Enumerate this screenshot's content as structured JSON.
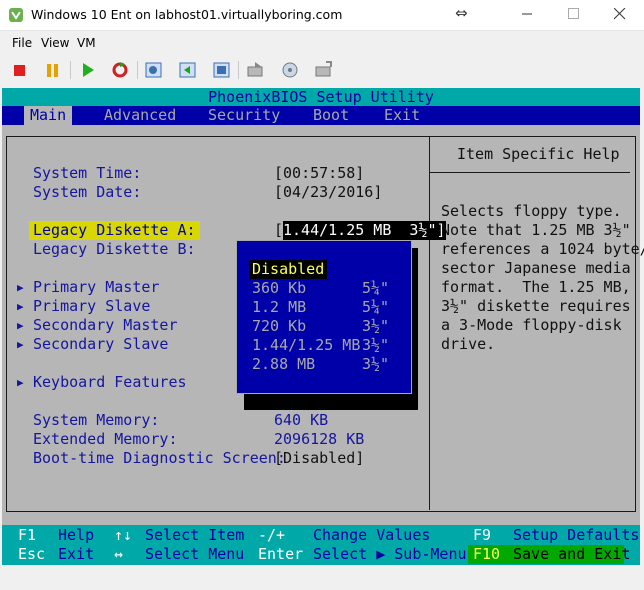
{
  "window": {
    "title": "Windows 10 Ent on labhost01.virtuallyboring.com",
    "resize_glyph": "⇔"
  },
  "menubar": [
    "File",
    "View",
    "VM"
  ],
  "toolbar": {
    "icons": [
      "stop-icon",
      "pause-icon",
      "play-icon",
      "reset-icon",
      "snapshot-icon",
      "revert-icon",
      "manage-snapshots-icon",
      "ctrl-alt-del-icon",
      "guest-install-icon",
      "enter-fullscreen-icon"
    ]
  },
  "bios": {
    "header": "PhoenixBIOS Setup Utility",
    "tabs": [
      "Main",
      "Advanced",
      "Security",
      "Boot",
      "Exit"
    ],
    "active_tab": "Main",
    "fields": [
      {
        "label": "System Time:",
        "value": "[00:57:58]"
      },
      {
        "label": "System Date:",
        "value": "[04/23/2016]"
      },
      {
        "label": "Legacy Diskette A:",
        "value": "[1.44/1.25 MB  3½\"]"
      },
      {
        "label": "Legacy Diskette B:",
        "value": ""
      }
    ],
    "submenus": [
      "Primary Master",
      "Primary Slave",
      "Secondary Master",
      "Secondary Slave",
      "Keyboard Features"
    ],
    "submenu_arrow": "▶",
    "memory": [
      {
        "label": "System Memory:",
        "value": "640 KB"
      },
      {
        "label": "Extended Memory:",
        "value": "2096128 KB"
      },
      {
        "label": "Boot-time Diagnostic Screen:",
        "value": "[Disabled]"
      }
    ],
    "value_prefix": "[",
    "selected_value_text": "1.44/1.25 MB  3½\"]",
    "help_title": "Item Specific Help",
    "help_lines": [
      "Selects floppy type.",
      "Note that 1.25 MB 3½\"",
      "references a 1024 byte/",
      "sector Japanese media",
      "format.  The 1.25 MB,",
      "3½\" diskette requires",
      "a 3-Mode floppy-disk",
      "drive."
    ],
    "popup": {
      "options": [
        {
          "label": "Disabled",
          "size": ""
        },
        {
          "label": "360 Kb",
          "size": "5¼\""
        },
        {
          "label": "1.2 MB",
          "size": "5¼\""
        },
        {
          "label": "720 Kb",
          "size": "3½\""
        },
        {
          "label": "1.44/1.25 MB",
          "size": "3½\""
        },
        {
          "label": "2.88 MB",
          "size": "3½\""
        }
      ],
      "selected": "Disabled"
    },
    "footer": {
      "row1": [
        {
          "key": "F1",
          "desc": "Help"
        },
        {
          "key": "↑↓",
          "desc": "Select Item"
        },
        {
          "key": "-/+",
          "desc": "Change Values"
        },
        {
          "key": "F9",
          "desc": "Setup Defaults"
        }
      ],
      "row2": [
        {
          "key": "Esc",
          "desc": "Exit"
        },
        {
          "key": "↔",
          "desc": "Select Menu"
        },
        {
          "key": "Enter",
          "desc": "Select ▶ Sub-Menu"
        },
        {
          "key": "F10",
          "desc": "Save and Exit"
        }
      ]
    }
  },
  "colors": {
    "bios_gray": "#b6b6b6",
    "bios_blue": "#0000a8",
    "bios_cyan": "#00a8a8",
    "highlight_yellow": "#d8d800",
    "save_green": "#00a800"
  }
}
